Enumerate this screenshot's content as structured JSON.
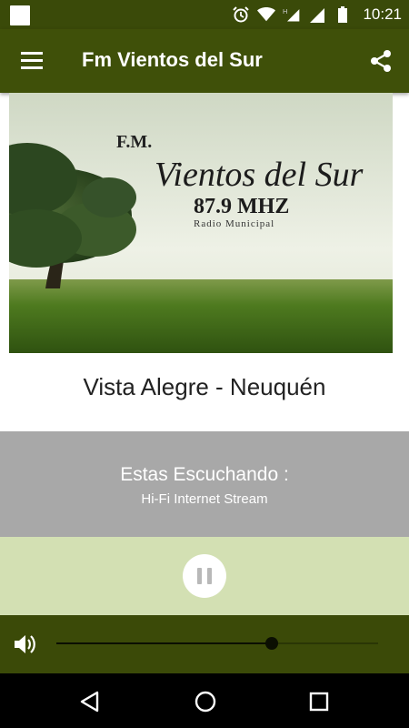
{
  "status_bar": {
    "time": "10:21",
    "signal_label": "H",
    "icons": [
      "notification-square-icon",
      "alarm-icon",
      "wifi-icon",
      "signal-h-icon",
      "signal-icon",
      "battery-icon"
    ]
  },
  "app_bar": {
    "title": "Fm Vientos del Sur",
    "menu_icon": "menu-icon",
    "share_icon": "share-icon",
    "color": "#3f5009"
  },
  "banner": {
    "fm_label": "F.M.",
    "station_name": "Vientos del Sur",
    "frequency": "87.9 MHZ",
    "subtitle": "Radio Municipal"
  },
  "location": "Vista Alegre - Neuquén",
  "now_playing": {
    "title": "Estas Escuchando :",
    "stream": "Hi-Fi Internet Stream"
  },
  "player": {
    "state": "playing",
    "control_icon": "pause-icon",
    "volume_fraction": 0.67
  },
  "nav_bar": {
    "icons": [
      "back-icon",
      "home-icon",
      "recents-icon"
    ]
  },
  "colors": {
    "status_bar": "#3a4a09",
    "app_bar": "#3f5009",
    "listen_panel": "#a8a8a8",
    "play_panel": "#d3e0b3",
    "volume_panel": "#3b4a08"
  }
}
